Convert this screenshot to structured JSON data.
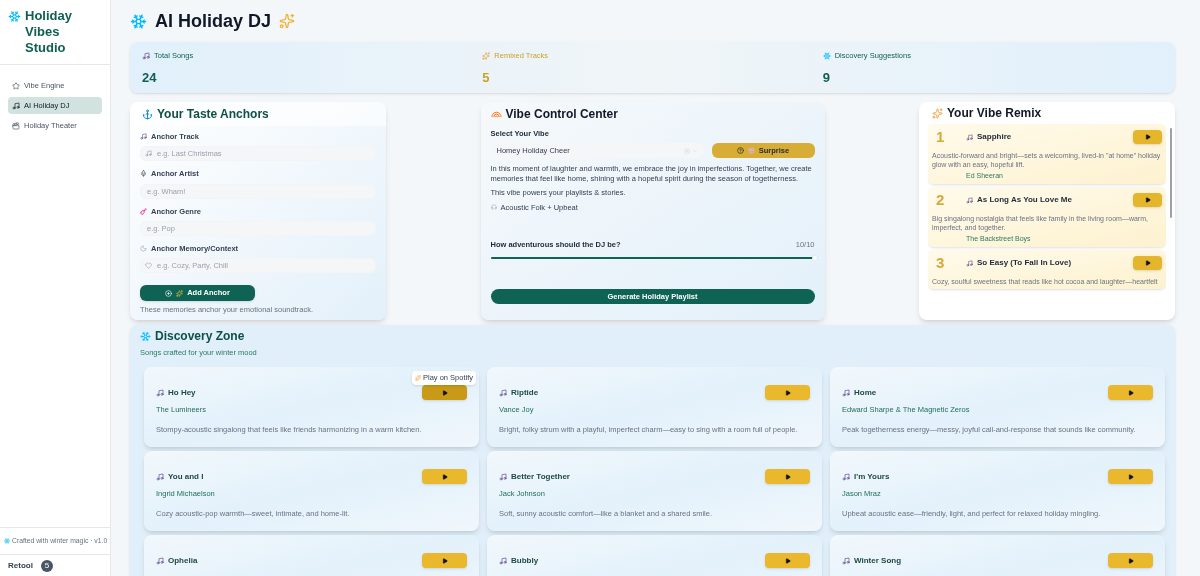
{
  "sidebar": {
    "brand": "Holiday Vibes Studio",
    "items": [
      {
        "label": "Vibe Engine",
        "selected": false
      },
      {
        "label": "AI Holiday DJ",
        "selected": true
      },
      {
        "label": "Holiday Theater",
        "selected": false
      }
    ],
    "footer": "Crafted with winter magic · v1.0",
    "retool": {
      "label": "Retool",
      "badge": "5"
    }
  },
  "page_title": "AI Holiday DJ",
  "stats": [
    {
      "label": "Total Songs",
      "value": "24",
      "color": "#0f5f52"
    },
    {
      "label": "Remixed Tracks",
      "value": "5",
      "color": "#c9a227"
    },
    {
      "label": "Discovery Suggestions",
      "value": "9",
      "color": "#0f5f52"
    }
  ],
  "anchors": {
    "title": "Your Taste Anchors",
    "fields": [
      {
        "label": "Anchor Track",
        "placeholder": "e.g. Last Christmas"
      },
      {
        "label": "Anchor Artist",
        "placeholder": "e.g. Wham!"
      },
      {
        "label": "Anchor Genre",
        "placeholder": "e.g. Pop"
      },
      {
        "label": "Anchor Memory/Context",
        "placeholder": "e.g. Cozy, Party, Chill"
      }
    ],
    "button": "Add Anchor",
    "note": "These memories anchor your emotional soundtrack."
  },
  "vibe": {
    "title": "Vibe Control Center",
    "select_label": "Select Your Vibe",
    "select_value": "Homey Holiday Cheer",
    "surprise": "Surprise",
    "description": "In this moment of laughter and warmth, we embrace the joy in imperfections. Together, we create memories that feel like home, shining with a hopeful spirit during the season of togetherness.",
    "note": "This vibe powers your playlists & stories.",
    "genre": "Acoustic Folk + Upbeat",
    "slider": {
      "label": "How adventurous should the DJ be?",
      "reading": "10/10",
      "level": 1
    },
    "generate": "Generate Holiday Playlist"
  },
  "remix": {
    "title": "Your Vibe Remix",
    "tracks": [
      {
        "rank": "1",
        "title": "Sapphire",
        "description": "Acoustic-forward and bright—sets a welcoming, lived-in \"at home\" holiday glow with an easy, hopeful lift.",
        "artist": "Ed Sheeran"
      },
      {
        "rank": "2",
        "title": "As Long As You Love Me",
        "description": "Big singalong nostalgia that feels like family in the living room—warm, imperfect, and together.",
        "artist": "The Backstreet Boys"
      },
      {
        "rank": "3",
        "title": "So Easy (To Fall In Love)",
        "description": "Cozy, soulful sweetness that reads like hot cocoa and laughter—heartfelt"
      }
    ]
  },
  "discovery": {
    "title": "Discovery Zone",
    "subtitle": "Songs crafted for your winter mood",
    "songs": [
      {
        "title": "Ho Hey",
        "artist": "The Lumineers",
        "description": "Stompy-acoustic singalong that feels like friends harmonizing in a warm kitchen.",
        "hovered": true,
        "tooltip": "Play on Spotify"
      },
      {
        "title": "Riptide",
        "artist": "Vance Joy",
        "description": "Bright, folky strum with a playful, imperfect charm—easy to sing with a room full of people.",
        "hovered": false
      },
      {
        "title": "Home",
        "artist": "Edward Sharpe & The Magnetic Zeros",
        "description": "Peak togetherness energy—messy, joyful call-and-response that sounds like community.",
        "hovered": false
      },
      {
        "title": "You and I",
        "artist": "Ingrid Michaelson",
        "description": "Cozy acoustic-pop warmth—sweet, intimate, and home-lit.",
        "hovered": false
      },
      {
        "title": "Better Together",
        "artist": "Jack Johnson",
        "description": "Soft, sunny acoustic comfort—like a blanket and a shared smile.",
        "hovered": false
      },
      {
        "title": "I'm Yours",
        "artist": "Jason Mraz",
        "description": "Upbeat acoustic ease—friendly, light, and perfect for relaxed holiday mingling.",
        "hovered": false
      },
      {
        "title": "Ophelia",
        "hovered": false
      },
      {
        "title": "Bubbly",
        "hovered": false
      },
      {
        "title": "Winter Song",
        "hovered": false
      }
    ]
  }
}
